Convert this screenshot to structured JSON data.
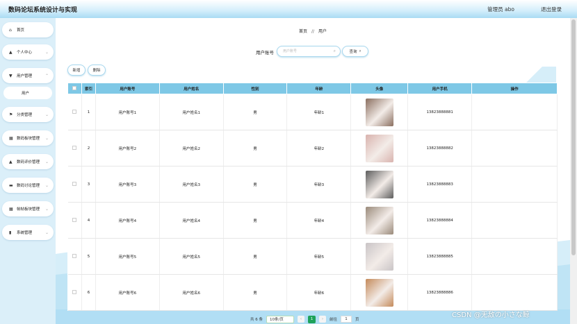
{
  "header": {
    "title": "数码论坛系统设计与实现",
    "user": "管理员 abo",
    "logout": "退出登录"
  },
  "sidebar": {
    "items": [
      {
        "label": "首页",
        "icon": "home-icon",
        "glyph": "⌂",
        "expanded": null
      },
      {
        "label": "个人中心",
        "icon": "user-icon",
        "glyph": "▲",
        "expanded": false
      },
      {
        "label": "用户管理",
        "icon": "user-manage-icon",
        "glyph": "▼",
        "expanded": true
      },
      {
        "label": "用户",
        "icon": "",
        "glyph": "",
        "sub": true
      },
      {
        "label": "分类管理",
        "icon": "flag-icon",
        "glyph": "⚑",
        "expanded": false
      },
      {
        "label": "数码板块管理",
        "icon": "grid-icon",
        "glyph": "▦",
        "expanded": false
      },
      {
        "label": "数码评价管理",
        "icon": "person-icon",
        "glyph": "▲",
        "expanded": false
      },
      {
        "label": "数码讨论管理",
        "icon": "car-icon",
        "glyph": "▬",
        "expanded": false
      },
      {
        "label": "帖帖板块管理",
        "icon": "grid-icon",
        "glyph": "▦",
        "expanded": false
      },
      {
        "label": "系统管理",
        "icon": "bar-chart-icon",
        "glyph": "▮",
        "expanded": false
      }
    ]
  },
  "breadcrumb": {
    "home": "首页",
    "sep": "//",
    "current": "用户"
  },
  "search": {
    "label": "用户账号",
    "placeholder": "用户账号",
    "value": "",
    "query_label": "查询"
  },
  "toolbar": {
    "add_label": "新增",
    "delete_label": "删除"
  },
  "table": {
    "headers": [
      "",
      "索引",
      "用户账号",
      "用户姓名",
      "性别",
      "年龄",
      "头像",
      "用户手机",
      "操作"
    ],
    "rows": [
      {
        "index": "1",
        "account": "用户账号1",
        "name": "用户姓名1",
        "gender": "男",
        "age": "年龄1",
        "phone": "13823888881",
        "avatar_color": "#8a6e5f"
      },
      {
        "index": "2",
        "account": "用户账号2",
        "name": "用户姓名2",
        "gender": "男",
        "age": "年龄2",
        "phone": "13823888882",
        "avatar_color": "#d9b3ae"
      },
      {
        "index": "3",
        "account": "用户账号3",
        "name": "用户姓名3",
        "gender": "男",
        "age": "年龄3",
        "phone": "13823888883",
        "avatar_color": "#5c5c5c"
      },
      {
        "index": "4",
        "account": "用户账号4",
        "name": "用户姓名4",
        "gender": "男",
        "age": "年龄4",
        "phone": "13823888884",
        "avatar_color": "#9a8a7a"
      },
      {
        "index": "5",
        "account": "用户账号5",
        "name": "用户姓名5",
        "gender": "男",
        "age": "年龄5",
        "phone": "13823888885",
        "avatar_color": "#c9c4c6"
      },
      {
        "index": "6",
        "account": "用户账号6",
        "name": "用户姓名6",
        "gender": "男",
        "age": "年龄6",
        "phone": "13823888886",
        "avatar_color": "#c48a5a"
      }
    ]
  },
  "pagination": {
    "total": "共 6 条",
    "page_size": "10条/页",
    "prev": "‹",
    "current": "1",
    "next": "›",
    "goto": "前往",
    "goto_value": "1",
    "page_unit": "页"
  },
  "watermark": "CSDN @无敌の小さな鲸",
  "colors": {
    "header_bg": "#a9dbf3",
    "table_header": "#7ec8e6",
    "active_page": "#1ea25a"
  }
}
